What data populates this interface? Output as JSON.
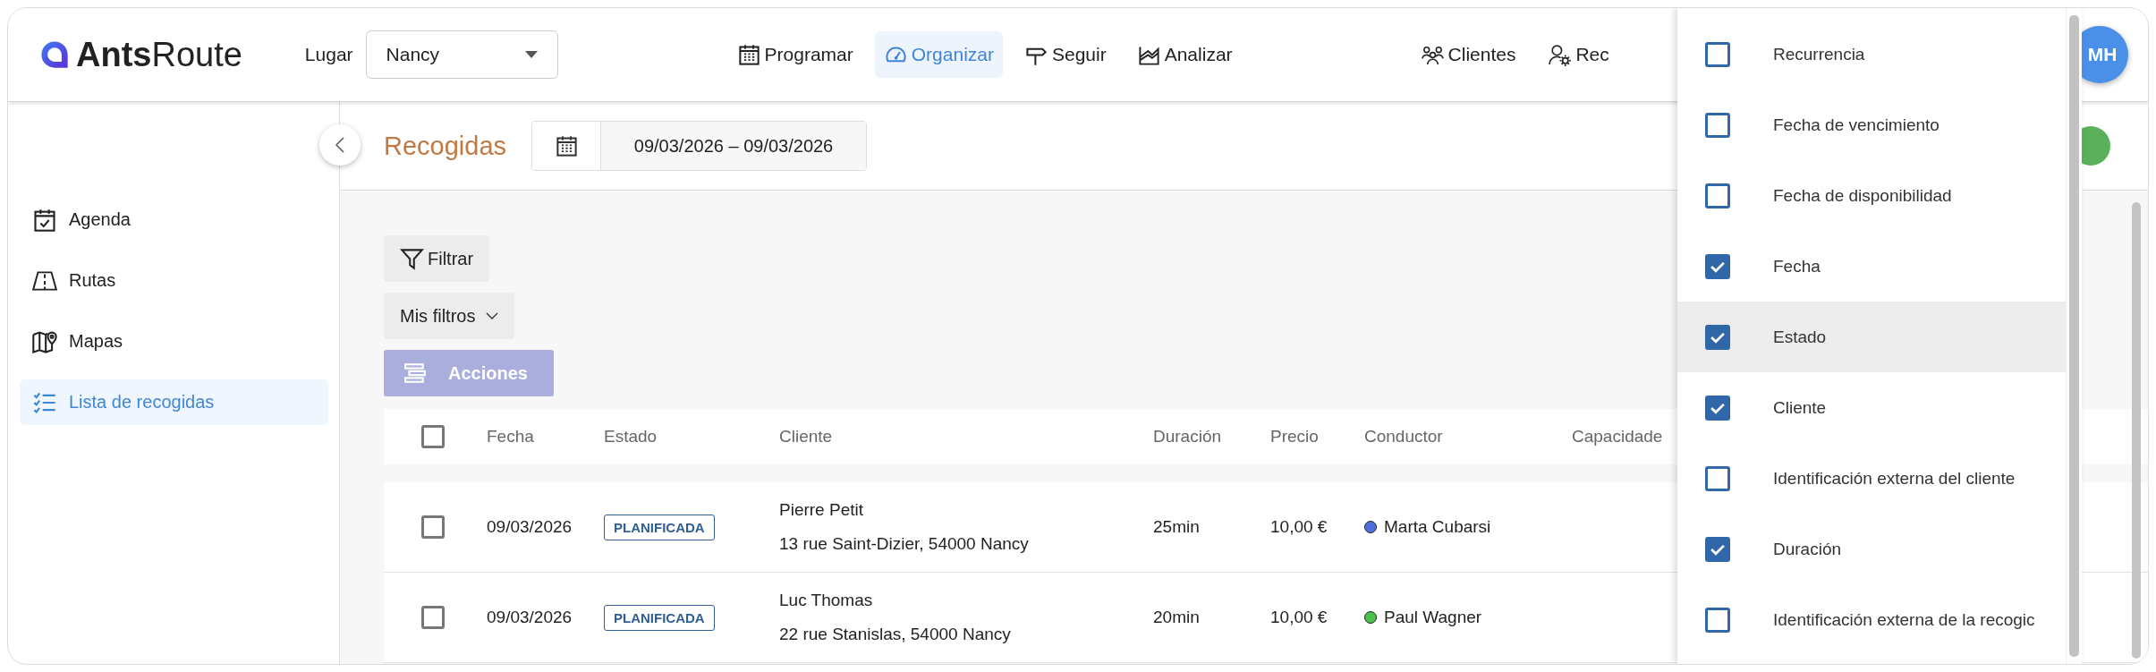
{
  "logo": {
    "text": "**Ants**Route"
  },
  "place": {
    "label": "Lugar",
    "value": "Nancy"
  },
  "nav": [
    {
      "label": "Programar",
      "selected": false
    },
    {
      "label": "Organizar",
      "selected": true
    },
    {
      "label": "Seguir",
      "selected": false
    },
    {
      "label": "Analizar",
      "selected": false
    }
  ],
  "nav_right": [
    {
      "label": "Clientes"
    },
    {
      "label": "Rec"
    }
  ],
  "avatar": {
    "initials": "MH"
  },
  "sidebar": {
    "items": [
      {
        "label": "Agenda",
        "selected": false
      },
      {
        "label": "Rutas",
        "selected": false
      },
      {
        "label": "Mapas",
        "selected": false
      },
      {
        "label": "Lista de recogidas",
        "selected": true
      }
    ]
  },
  "page": {
    "title": "Recogidas",
    "date_range": "09/03/2026 – 09/03/2026"
  },
  "toolbar": {
    "filter": "Filtrar",
    "my_filters": "Mis filtros",
    "actions": {
      "label": "Acciones",
      "disabled": true
    }
  },
  "table": {
    "select_all": {
      "checked": false
    },
    "columns": [
      "Fecha",
      "Estado",
      "Cliente",
      "Duración",
      "Precio",
      "Conductor",
      "Capacidade"
    ],
    "rows": [
      {
        "checked": false,
        "date": "09/03/2026",
        "status": "PLANIFICADA",
        "client": "Pierre Petit",
        "address": "13 rue Saint-Dizier, 54000 Nancy",
        "duration": "25min",
        "price": "10,00 €",
        "driver": "Marta Cubarsi",
        "color": "#4f6fdc"
      },
      {
        "checked": false,
        "date": "09/03/2026",
        "status": "PLANIFICADA",
        "client": "Luc Thomas",
        "address": "22 rue Stanislas, 54000 Nancy",
        "duration": "20min",
        "price": "10,00 €",
        "driver": "Paul Wagner",
        "color": "#4cc24c"
      }
    ]
  },
  "column_menu": {
    "options": [
      {
        "label": "Recurrencia",
        "checked": false,
        "hovered": false
      },
      {
        "label": "Fecha de vencimiento",
        "checked": false,
        "hovered": false
      },
      {
        "label": "Fecha de disponibilidad",
        "checked": false,
        "hovered": false
      },
      {
        "label": "Fecha",
        "checked": true,
        "hovered": false
      },
      {
        "label": "Estado",
        "checked": true,
        "hovered": true
      },
      {
        "label": "Cliente",
        "checked": true,
        "hovered": false
      },
      {
        "label": "Identificación externa del cliente",
        "checked": false,
        "hovered": false
      },
      {
        "label": "Duración",
        "checked": true,
        "hovered": false
      },
      {
        "label": "Identificación externa de la recogic",
        "checked": false,
        "hovered": false
      }
    ]
  }
}
